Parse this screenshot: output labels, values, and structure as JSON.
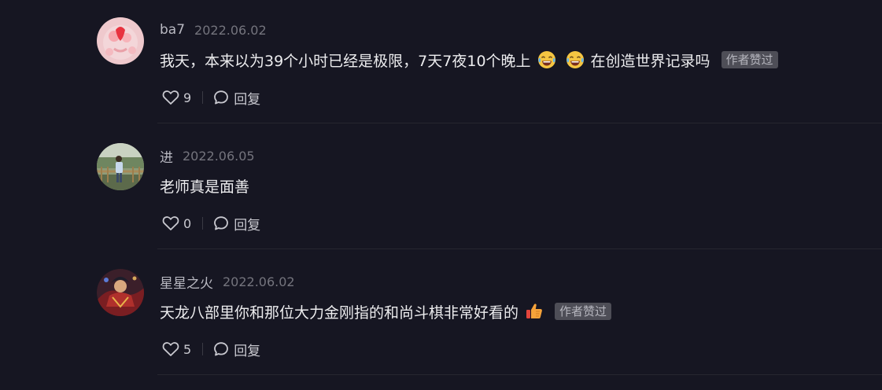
{
  "comments": [
    {
      "username": "ba7",
      "date": "2022.06.02",
      "text": "我天，本来以为39个小时已经是极限，7天7夜10个晚上",
      "emojis": [
        "laugh-cry-icon",
        "laugh-cry-icon"
      ],
      "text_after": "在创造世界记录吗",
      "badge": "作者赞过",
      "likes": "9",
      "reply_label": "回复"
    },
    {
      "username": "进",
      "date": "2022.06.05",
      "text": "老师真是面善",
      "likes": "0",
      "reply_label": "回复"
    },
    {
      "username": "星星之火",
      "date": "2022.06.02",
      "text": "天龙八部里你和那位大力金刚指的和尚斗棋非常好看的",
      "emojis": [
        "thumbs-up-icon"
      ],
      "badge": "作者赞过",
      "likes": "5",
      "reply_label": "回复"
    }
  ],
  "colors": {
    "background": "#161622",
    "text": "#ececee",
    "muted": "#74747d",
    "badge_bg": "#4e4e57"
  }
}
